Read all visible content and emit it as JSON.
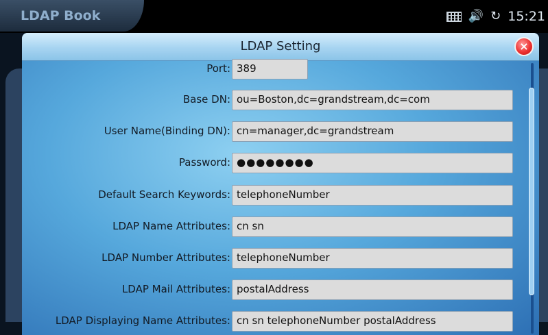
{
  "app": {
    "title": "LDAP Book"
  },
  "status": {
    "time": "15:21"
  },
  "dialog": {
    "title": "LDAP Setting",
    "close_label": "×",
    "fields": [
      {
        "label": "Port:",
        "value": "389"
      },
      {
        "label": "Base DN:",
        "value": "ou=Boston,dc=grandstream,dc=com"
      },
      {
        "label": "User Name(Binding DN):",
        "value": "cn=manager,dc=grandstream"
      },
      {
        "label": "Password:",
        "value": "●●●●●●●●"
      },
      {
        "label": "Default Search Keywords:",
        "value": "telephoneNumber"
      },
      {
        "label": "LDAP Name Attributes:",
        "value": "cn sn"
      },
      {
        "label": "LDAP Number Attributes:",
        "value": "telephoneNumber"
      },
      {
        "label": "LDAP Mail Attributes:",
        "value": "postalAddress"
      },
      {
        "label": "LDAP Displaying Name Attributes:",
        "value": "cn sn telephoneNumber postalAddress"
      }
    ]
  },
  "icons": {
    "keyboard": "keyboard-icon",
    "volume": "volume-icon",
    "sync": "sync-icon",
    "close": "close-icon"
  },
  "colors": {
    "dialog_accent": "#56a8dc",
    "close_red": "#e33333",
    "input_bg": "#dcdcdc"
  }
}
